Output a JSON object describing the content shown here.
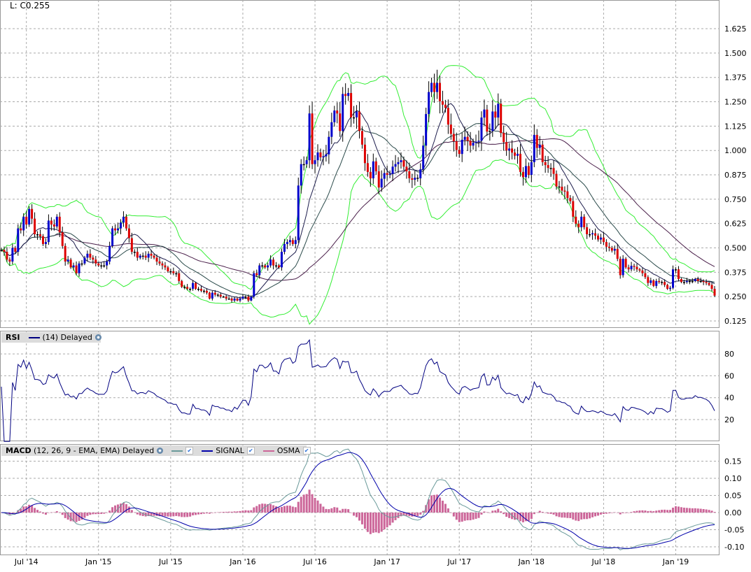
{
  "header": {
    "last_label": "L: C0.255"
  },
  "rsi_legend": {
    "title": "RSI",
    "params": "(14) Delayed",
    "icon": "refresh-gear-icon"
  },
  "macd_legend": {
    "title": "MACD",
    "params": "(12, 26, 9 - EMA, EMA) Delayed",
    "signal": "SIGNAL",
    "osma": "OSMA",
    "icon": "refresh-gear-icon"
  },
  "colors": {
    "up": "#0000cc",
    "down": "#dd0000",
    "doji": "#000000",
    "bollinger": "#33ee33",
    "sma_fast": "#1c1c4c",
    "sma_mid": "#2a4a4a",
    "sma_slow": "#4a1f4a",
    "rsi": "#000080",
    "macd": "#6a9a9a",
    "signal": "#0000aa",
    "osma": "#cc6699"
  },
  "chart_data": [
    {
      "type": "candlestick",
      "title": "Price",
      "interval": "weekly",
      "x_labels": [
        {
          "label": "Jul '14",
          "week": 9
        },
        {
          "label": "Jan '15",
          "week": 35
        },
        {
          "label": "Jul '15",
          "week": 61
        },
        {
          "label": "Jan '16",
          "week": 87
        },
        {
          "label": "Jul '16",
          "week": 113
        },
        {
          "label": "Jan '17",
          "week": 139
        },
        {
          "label": "Jul '17",
          "week": 165
        },
        {
          "label": "Jan '18",
          "week": 191
        },
        {
          "label": "Jul '18",
          "week": 217
        },
        {
          "label": "Jan '19",
          "week": 243
        }
      ],
      "y_ticks": [
        "0.125",
        "0.250",
        "0.375",
        "0.500",
        "0.625",
        "0.750",
        "0.875",
        "1.000",
        "1.125",
        "1.250",
        "1.375",
        "1.500",
        "1.625"
      ],
      "ylim": [
        0.09,
        1.74
      ],
      "overlays": [
        "SMA 10",
        "SMA 20",
        "SMA 50",
        "Bollinger Bands (20, 2)"
      ],
      "close": [
        0.49,
        0.48,
        0.44,
        0.43,
        0.5,
        0.48,
        0.6,
        0.59,
        0.66,
        0.62,
        0.7,
        0.65,
        0.57,
        0.57,
        0.56,
        0.52,
        0.53,
        0.64,
        0.62,
        0.61,
        0.66,
        0.58,
        0.51,
        0.43,
        0.44,
        0.4,
        0.41,
        0.37,
        0.42,
        0.42,
        0.45,
        0.47,
        0.45,
        0.44,
        0.42,
        0.41,
        0.41,
        0.41,
        0.43,
        0.51,
        0.6,
        0.59,
        0.6,
        0.63,
        0.66,
        0.6,
        0.55,
        0.48,
        0.48,
        0.45,
        0.46,
        0.46,
        0.45,
        0.47,
        0.46,
        0.45,
        0.43,
        0.42,
        0.41,
        0.4,
        0.38,
        0.38,
        0.37,
        0.37,
        0.33,
        0.3,
        0.3,
        0.29,
        0.29,
        0.32,
        0.29,
        0.29,
        0.28,
        0.28,
        0.27,
        0.24,
        0.27,
        0.26,
        0.26,
        0.25,
        0.25,
        0.24,
        0.24,
        0.23,
        0.24,
        0.23,
        0.24,
        0.25,
        0.25,
        0.23,
        0.25,
        0.37,
        0.36,
        0.41,
        0.41,
        0.4,
        0.41,
        0.44,
        0.41,
        0.41,
        0.4,
        0.48,
        0.52,
        0.53,
        0.54,
        0.52,
        0.54,
        0.82,
        0.93,
        0.93,
        0.95,
        1.19,
        0.93,
        0.95,
        0.99,
        0.965,
        0.97,
        0.98,
        1.07,
        1.145,
        1.205,
        1.19,
        1.1,
        1.29,
        1.28,
        1.295,
        1.17,
        1.17,
        1.2,
        1.1,
        1.03,
        0.935,
        0.89,
        0.857,
        0.944,
        0.893,
        0.81,
        0.855,
        0.884,
        0.875,
        0.88,
        0.917,
        0.93,
        0.94,
        0.95,
        0.917,
        0.893,
        0.857,
        0.85,
        0.86,
        0.857,
        0.903,
        1.025,
        1.187,
        1.3,
        1.347,
        1.3,
        1.347,
        1.253,
        1.235,
        1.219,
        1.133,
        1.085,
        1.047,
        1.003,
        0.982,
        1.055,
        1.07,
        1.05,
        1.025,
        1.04,
        1.045,
        1.05,
        1.169,
        1.21,
        1.097,
        1.1,
        1.2,
        1.169,
        1.24,
        1.09,
        1.043,
        1.0,
        1.01,
        0.989,
        0.973,
        0.983,
        0.89,
        0.863,
        0.92,
        0.875,
        0.94,
        1.08,
        1.013,
        1.03,
        0.94,
        0.925,
        0.91,
        0.91,
        0.88,
        0.815,
        0.814,
        0.794,
        0.79,
        0.756,
        0.74,
        0.66,
        0.624,
        0.606,
        0.66,
        0.606,
        0.57,
        0.57,
        0.575,
        0.563,
        0.543,
        0.553,
        0.53,
        0.506,
        0.5,
        0.486,
        0.495,
        0.444,
        0.36,
        0.444,
        0.4,
        0.39,
        0.408,
        0.403,
        0.39,
        0.384,
        0.37,
        0.35,
        0.32,
        0.333,
        0.305,
        0.33,
        0.325,
        0.325,
        0.31,
        0.29,
        0.295,
        0.39,
        0.39,
        0.34,
        0.325,
        0.325,
        0.33,
        0.33,
        0.33,
        0.34,
        0.33,
        0.33,
        0.325,
        0.32,
        0.31,
        0.29,
        0.255
      ]
    },
    {
      "type": "line",
      "title": "RSI (14)",
      "y_ticks": [
        "20",
        "40",
        "60",
        "80"
      ],
      "ylim": [
        0,
        100
      ],
      "derived_from": "close"
    },
    {
      "type": "line+bar",
      "title": "MACD (12, 26, 9)",
      "y_ticks": [
        "-0.10",
        "-0.05",
        "0.00",
        "0.05",
        "0.10",
        "0.15"
      ],
      "ylim": [
        -0.124,
        0.19
      ],
      "series": [
        "MACD",
        "SIGNAL",
        "OSMA"
      ],
      "derived_from": "close"
    }
  ]
}
